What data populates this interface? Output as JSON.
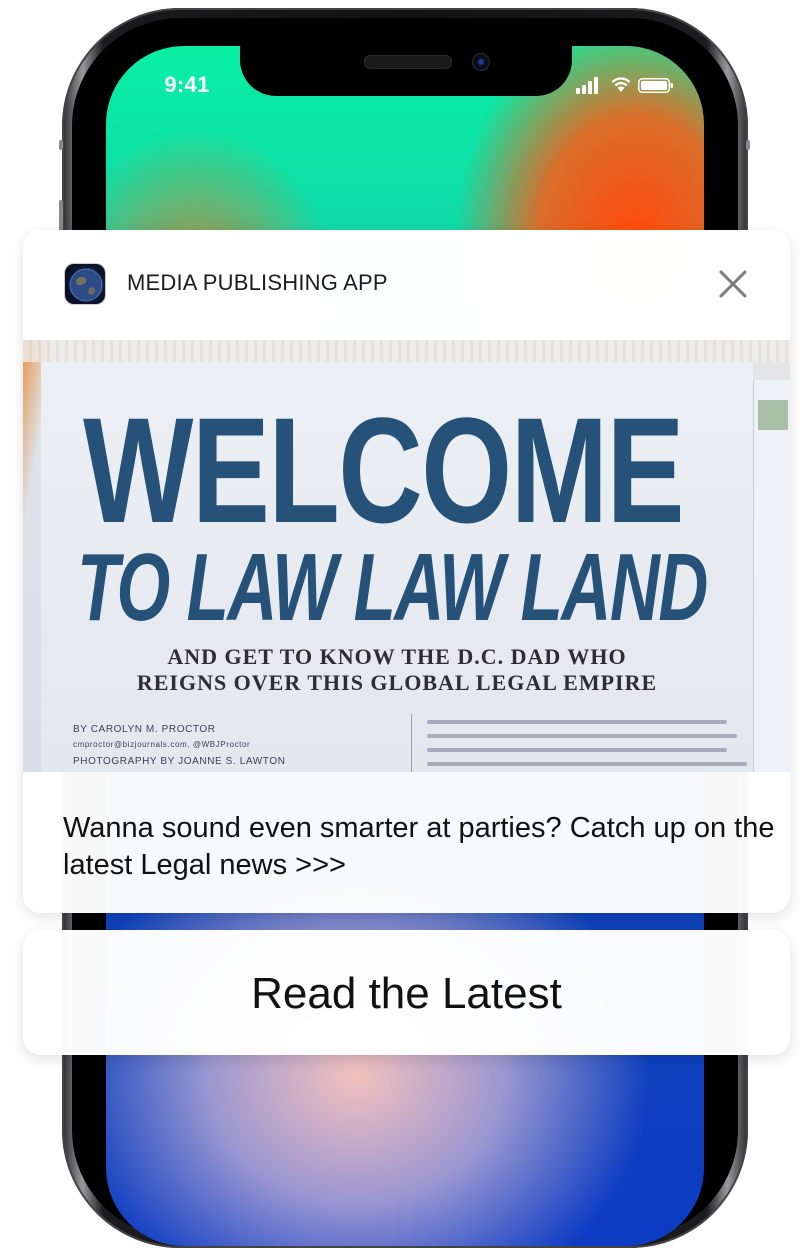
{
  "status_bar": {
    "time": "9:41",
    "icons": [
      "signal-icon",
      "wifi-icon",
      "battery-icon"
    ]
  },
  "notification": {
    "app_icon": "globe-app-icon",
    "app_name": "MEDIA PUBLISHING APP",
    "close_icon": "close-icon",
    "hero_image": {
      "headline_1": "WELCOME",
      "headline_2": "TO LAW LAW LAND",
      "deck_1": "AND GET TO KNOW THE D.C. DAD WHO",
      "deck_2": "REIGNS OVER THIS GLOBAL LEGAL EMPIRE",
      "byline_1": "BY CAROLYN M. PROCTOR",
      "byline_2": "cmproctor@bizjournals.com, @WBJProctor",
      "byline_3": "PHOTOGRAPHY BY JOANNE S. LAWTON"
    },
    "message": "Wanna sound even smarter at parties? Catch up on the latest Legal news >>>"
  },
  "action": {
    "label": "Read the Latest"
  },
  "colors": {
    "headline": "#26527a",
    "screen_top": "#08f0a4",
    "screen_bottom": "#0c3cc4",
    "accent_orange": "#ff4a0c"
  }
}
